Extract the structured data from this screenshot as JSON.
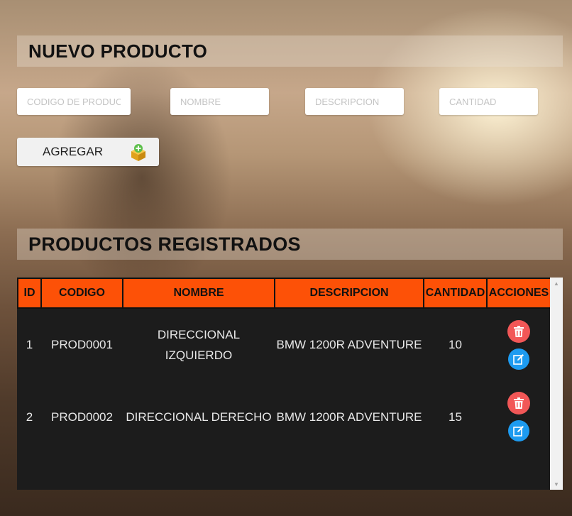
{
  "new_product": {
    "title": "NUEVO PRODUCTO",
    "fields": {
      "codigo_placeholder": "CODIGO DE PRODUCTO",
      "nombre_placeholder": "NOMBRE",
      "descripcion_placeholder": "DESCRIPCION",
      "cantidad_placeholder": "CANTIDAD"
    },
    "add_button": {
      "label": "AGREGAR",
      "icon": "box-add-icon"
    }
  },
  "products": {
    "title": "PRODUCTOS REGISTRADOS",
    "columns": [
      "ID",
      "CODIGO",
      "NOMBRE",
      "DESCRIPCION",
      "CANTIDAD",
      "ACCIONES"
    ],
    "rows": [
      {
        "id": "1",
        "codigo": "PROD0001",
        "nombre": "DIRECCIONAL IZQUIERDO",
        "descripcion": "BMW 1200R ADVENTURE",
        "cantidad": "10"
      },
      {
        "id": "2",
        "codigo": "PROD0002",
        "nombre": "DIRECCIONAL DERECHO",
        "descripcion": "BMW 1200R ADVENTURE",
        "cantidad": "15"
      }
    ],
    "actions": {
      "delete_icon": "trash-icon",
      "edit_icon": "edit-icon"
    }
  },
  "colors": {
    "header_orange": "#fd5107",
    "table_bg": "#1c1c1c",
    "delete_red": "#f25757",
    "edit_blue": "#1d9bf0"
  }
}
